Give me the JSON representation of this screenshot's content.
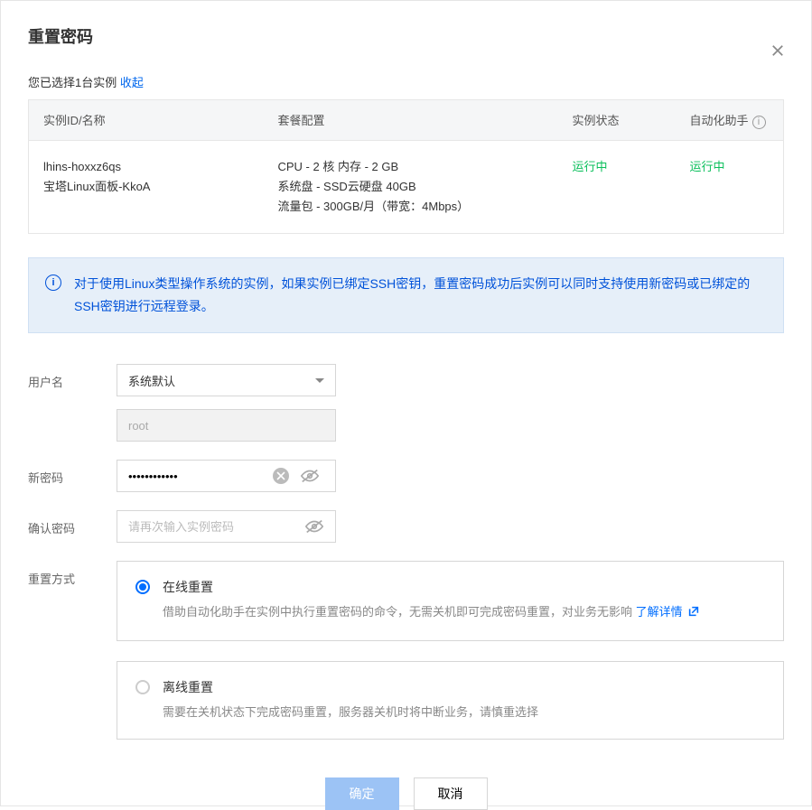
{
  "title": "重置密码",
  "selected_prefix": "您已选择1台实例 ",
  "collapse": "收起",
  "table": {
    "headers": {
      "id": "实例ID/名称",
      "pkg": "套餐配置",
      "status": "实例状态",
      "auto": "自动化助手"
    },
    "row": {
      "id": "lhins-hoxxz6qs",
      "name": "宝塔Linux面板-KkoA",
      "pkg1": "CPU - 2 核 内存 - 2 GB",
      "pkg2": "系统盘 - SSD云硬盘 40GB",
      "pkg3": "流量包 - 300GB/月（带宽：4Mbps）",
      "status": "运行中",
      "auto": "运行中"
    }
  },
  "info": "对于使用Linux类型操作系统的实例，如果实例已绑定SSH密钥，重置密码成功后实例可以同时支持使用新密码或已绑定的SSH密钥进行远程登录。",
  "form": {
    "user_label": "用户名",
    "user_value": "系统默认",
    "user_ro": "root",
    "pwd_label": "新密码",
    "pwd_value": "••••••••••••",
    "confirm_label": "确认密码",
    "confirm_ph": "请再次输入实例密码",
    "mode_label": "重置方式",
    "online": {
      "title": "在线重置",
      "desc": "借助自动化助手在实例中执行重置密码的命令，无需关机即可完成密码重置，对业务无影响 ",
      "link": "了解详情"
    },
    "offline": {
      "title": "离线重置",
      "desc": "需要在关机状态下完成密码重置，服务器关机时将中断业务，请慎重选择"
    }
  },
  "buttons": {
    "ok": "确定",
    "cancel": "取消"
  }
}
